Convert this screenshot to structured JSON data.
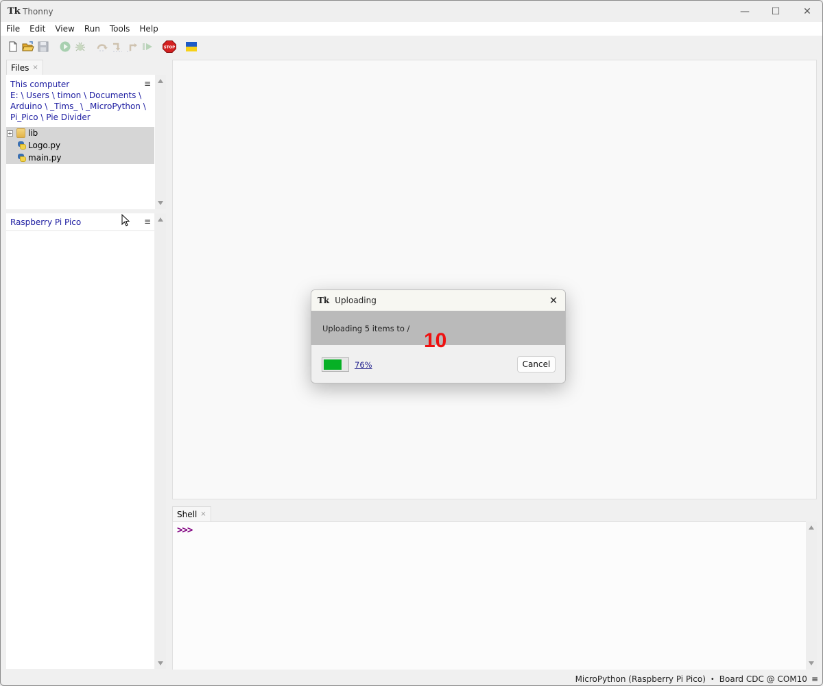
{
  "window": {
    "title": "Thonny",
    "app_icon": "Tk",
    "controls": {
      "minimize": "—",
      "maximize": "☐",
      "close": "✕"
    }
  },
  "menubar": {
    "items": [
      "File",
      "Edit",
      "View",
      "Run",
      "Tools",
      "Help"
    ]
  },
  "toolbar": {
    "buttons": [
      {
        "name": "new-file",
        "enabled": true
      },
      {
        "name": "open-file",
        "enabled": true
      },
      {
        "name": "save-file",
        "enabled": false
      },
      {
        "name": "run",
        "enabled": false
      },
      {
        "name": "debug",
        "enabled": false
      },
      {
        "name": "step-over",
        "enabled": false
      },
      {
        "name": "step-into",
        "enabled": false
      },
      {
        "name": "step-out",
        "enabled": false
      },
      {
        "name": "resume",
        "enabled": false
      },
      {
        "name": "stop",
        "enabled": true,
        "label": "STOP"
      },
      {
        "name": "support-ukraine",
        "enabled": true
      }
    ]
  },
  "files_panel": {
    "tab_label": "Files",
    "tab_close": "×",
    "this_computer": {
      "heading": "This computer",
      "path_lines": [
        "E: \\ Users \\ timon \\ Documents \\",
        "Arduino \\ _Tims_ \\ _MicroPython \\",
        "Pi_Pico \\ Pie Divider"
      ],
      "menu_icon": "≡",
      "items": [
        {
          "name": "lib",
          "type": "folder",
          "expand": "+"
        },
        {
          "name": "Logo.py",
          "type": "python"
        },
        {
          "name": "main.py",
          "type": "python"
        }
      ]
    },
    "device": {
      "heading": "Raspberry Pi Pico",
      "menu_icon": "≡"
    }
  },
  "shell": {
    "tab_label": "Shell",
    "tab_close": "×",
    "prompt": ">>>"
  },
  "statusbar": {
    "interpreter": "MicroPython (Raspberry Pi Pico)",
    "separator": "•",
    "port": "Board CDC @ COM10",
    "menu_icon": "≡"
  },
  "dialog": {
    "title": "Uploading",
    "app_icon": "Tk",
    "close": "✕",
    "message": "Uploading 5 items to /",
    "progress_percent": 76,
    "progress_label": "76%",
    "cancel_label": "Cancel",
    "overlay_number": "10"
  },
  "colors": {
    "progress_fill": "#06b025",
    "overlay_number": "#ee1111",
    "path_text": "#1a1aa0",
    "shell_prompt": "#800080"
  }
}
